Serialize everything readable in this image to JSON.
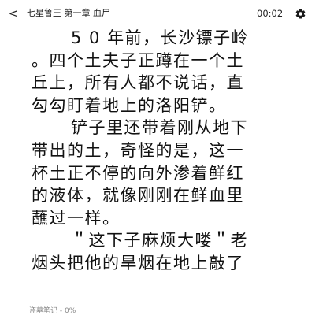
{
  "header": {
    "back_icon": "chevron-left-icon",
    "back_glyph": "<",
    "chapter_title": "七星鲁王 第一章 血尸",
    "time": "00:02",
    "settings_icon": "gear-icon"
  },
  "content": {
    "lines": [
      "5 0 年前，长沙镖子岭",
      "。四个土夫子正蹲在一个土",
      "丘上，所有人都不说话，直",
      "勾勾盯着地上的洛阳铲。",
      "铲子里还带着刚从地下",
      "带出的土，奇怪的是，这一",
      "杯土正不停的向外渗着鲜红",
      "的液体，就像刚刚在鲜血里",
      "蘸过一样。",
      "＂这下子麻烦大喽＂老",
      "烟头把他的旱烟在地上敲了"
    ]
  },
  "footer": {
    "note_status": "盗墓笔记 - 0%"
  }
}
